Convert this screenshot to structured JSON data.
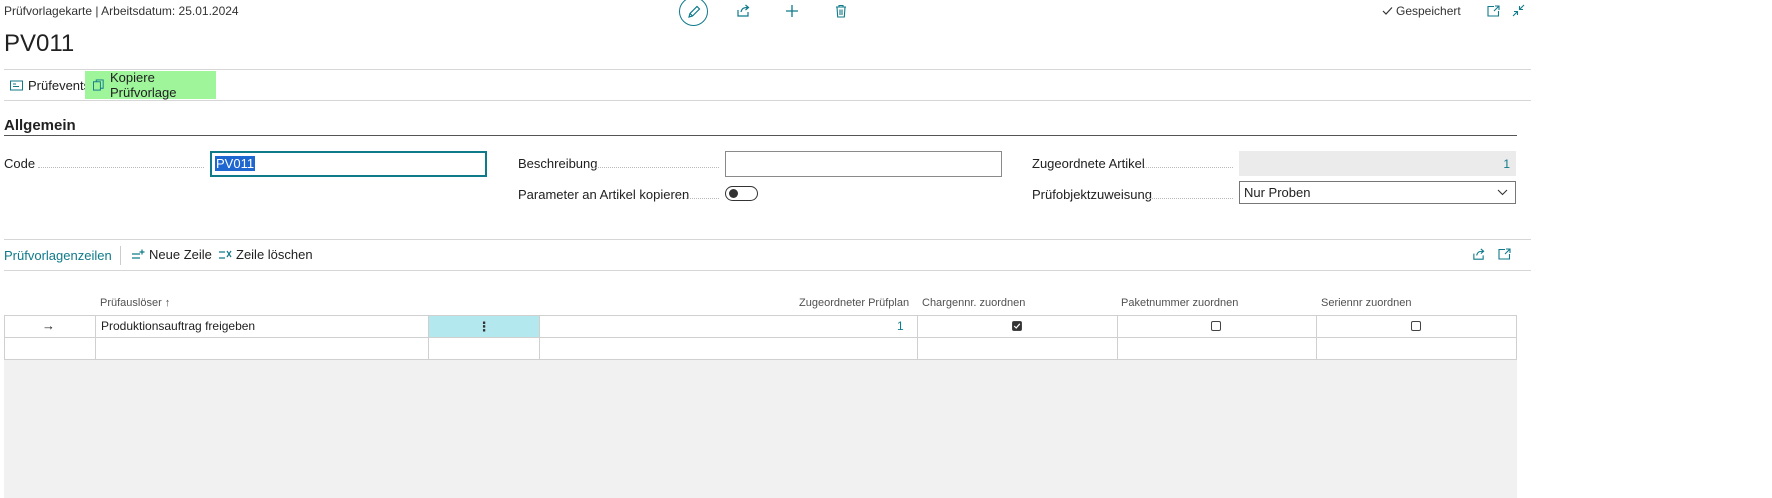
{
  "header": {
    "breadcrumb": "Prüfvorlagekarte | Arbeitsdatum: 25.01.2024",
    "status": "Gespeichert",
    "title": "PV011"
  },
  "actions": {
    "prufevents_label": "Prüfevents",
    "kopiere_label": "Kopiere Prüfvorlage"
  },
  "section": {
    "title": "Allgemein"
  },
  "fields": {
    "code_label": "Code",
    "code_value": "PV011",
    "beschreibung_label": "Beschreibung",
    "beschreibung_value": "",
    "parameter_label": "Parameter an Artikel kopieren",
    "parameter_on": false,
    "artikel_label": "Zugeordnete Artikel",
    "artikel_value": "1",
    "zuweisung_label": "Prüfobjektzuweisung",
    "zuweisung_value": "Nur Proben"
  },
  "lines": {
    "title": "Prüfvorlagenzeilen",
    "new_line": "Neue Zeile",
    "delete_line": "Zeile löschen",
    "columns": {
      "ausloser": "Prüfauslöser ↑",
      "prufplan": "Zugeordneter Prüfplan",
      "charge": "Chargennr. zuordnen",
      "paket": "Paketnummer zuordnen",
      "serie": "Seriennr zuordnen"
    },
    "rows": [
      {
        "indicator": "→",
        "ausloser": "Produktionsauftrag freigeben",
        "menu": "⋮",
        "prufplan": "1",
        "charge": true,
        "paket": false,
        "serie": false
      },
      {
        "indicator": "",
        "ausloser": "",
        "menu": "",
        "prufplan": "",
        "charge": null,
        "paket": null,
        "serie": null
      }
    ]
  },
  "colors": {
    "accent": "#0f7a8a",
    "highlight_green": "#9ef59a",
    "row_menu_bg": "#b3e8ee",
    "selection_blue": "#1e66d0"
  }
}
